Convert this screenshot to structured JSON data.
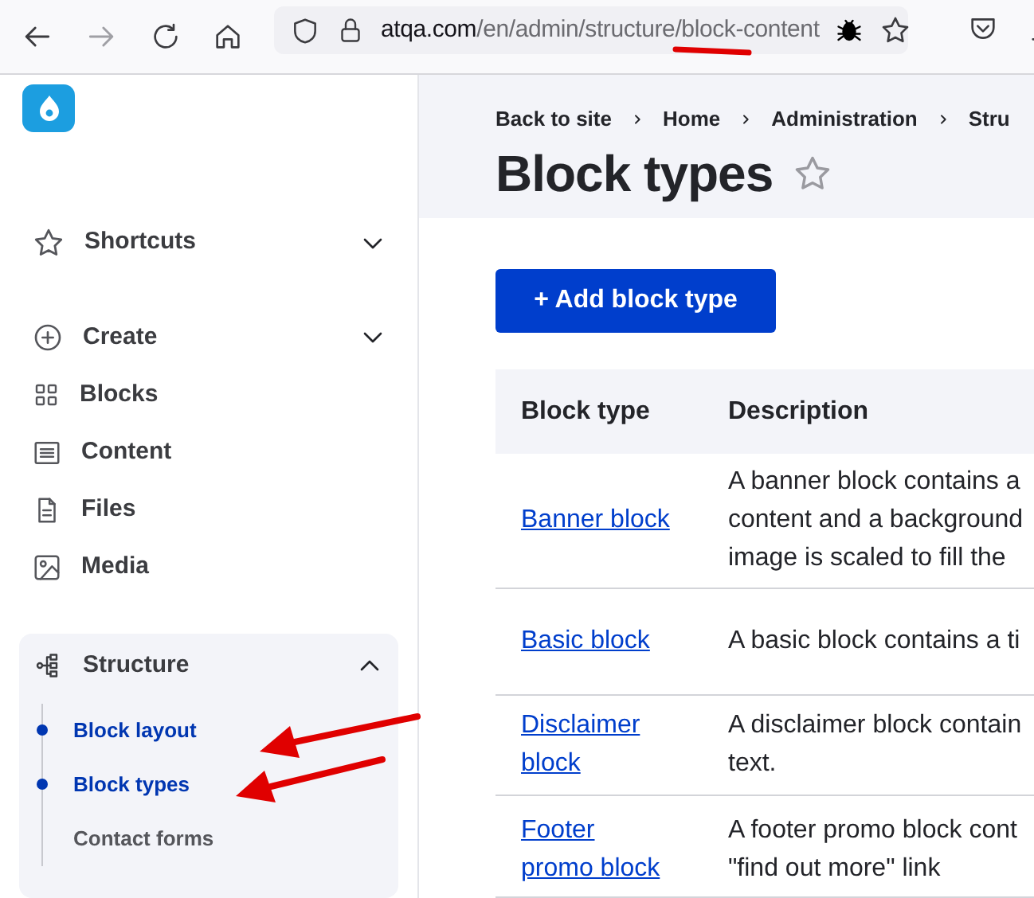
{
  "browser": {
    "url_domain": "atqa.com",
    "url_path": "/en/admin/structure/block-content"
  },
  "sidebar": {
    "shortcuts": {
      "label": "Shortcuts",
      "expanded": false
    },
    "items": [
      {
        "label": "Create",
        "expanded": false,
        "kind": "menu"
      },
      {
        "label": "Blocks",
        "kind": "link"
      },
      {
        "label": "Content",
        "kind": "link"
      },
      {
        "label": "Files",
        "kind": "link"
      },
      {
        "label": "Media",
        "kind": "link"
      }
    ],
    "structure": {
      "label": "Structure",
      "expanded": true,
      "children": [
        {
          "label": "Block layout",
          "active": true
        },
        {
          "label": "Block types",
          "active": true
        },
        {
          "label": "Contact forms",
          "active": false
        }
      ]
    }
  },
  "breadcrumb": [
    "Back to site",
    "Home",
    "Administration",
    "Stru"
  ],
  "page_title": "Block types",
  "favorite": false,
  "add_button": "+ Add block type",
  "table": {
    "columns": [
      "Block type",
      "Description"
    ],
    "rows": [
      {
        "name": [
          "Banner block"
        ],
        "description": [
          "A banner block contains a",
          "content and a background",
          "image is scaled to fill the"
        ]
      },
      {
        "name": [
          "Basic block"
        ],
        "description": [
          "A basic block contains a ti"
        ]
      },
      {
        "name": [
          "Disclaimer",
          "block"
        ],
        "description": [
          "A disclaimer block contain",
          "text."
        ]
      },
      {
        "name": [
          "Footer",
          "promo block"
        ],
        "description": [
          "A footer promo block cont",
          "\"find out more\" link"
        ]
      }
    ]
  }
}
